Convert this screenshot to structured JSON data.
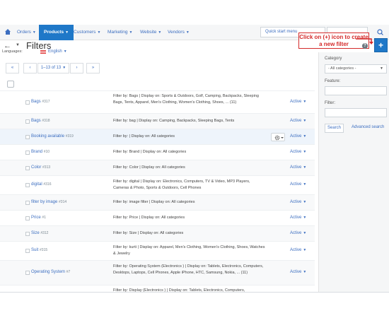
{
  "nav": {
    "items": [
      {
        "label": "Orders",
        "active": false
      },
      {
        "label": "Products",
        "active": true
      },
      {
        "label": "Customers",
        "active": false
      },
      {
        "label": "Marketing",
        "active": false
      },
      {
        "label": "Website",
        "active": false
      },
      {
        "label": "Vendors",
        "active": false
      }
    ],
    "quickstart": "Quick start menu"
  },
  "header": {
    "title": "Filters",
    "callout": "Click on (+) icon to create a new filter",
    "help": "?",
    "add": "+"
  },
  "languages": {
    "label": "Languages:",
    "value": "English"
  },
  "pagination": {
    "first": "«",
    "prev": "‹",
    "range": "1–13 of 13",
    "next": "›",
    "last": "»"
  },
  "rows": [
    {
      "name": "Bags",
      "id": "#317",
      "desc": "Filter by: Bags | Display on: Sports & Outdoors, Golf, Camping, Backpacks, Sleeping Bags, Tents, Apparel, Men's Clothing, Women's Clothing, Shoes, ... (11)",
      "status": "Active"
    },
    {
      "name": "Bags",
      "id": "#318",
      "desc": "Filter by: bag | Display on: Camping, Backpacks, Sleeping Bags, Tents",
      "status": "Active"
    },
    {
      "name": "Booking available",
      "id": "#319",
      "desc": "Filter by: | Display on: All categories",
      "status": "Active"
    },
    {
      "name": "Brand",
      "id": "#10",
      "desc": "Filter by: Brand | Display on: All categories",
      "status": "Active"
    },
    {
      "name": "Color",
      "id": "#313",
      "desc": "Filter by: Color | Display on: All categories",
      "status": "Active"
    },
    {
      "name": "digital",
      "id": "#316",
      "desc": "Filter by: digital | Display on: Electronics, Computers, TV & Video, MP3 Players, Cameras & Photo, Sports & Outdoors, Cell Phones",
      "status": "Active"
    },
    {
      "name": "filter by image",
      "id": "#314",
      "desc": "Filter by: image filter | Display on: All categories",
      "status": "Active"
    },
    {
      "name": "Price",
      "id": "#1",
      "desc": "Filter by: Price | Display on: All categories",
      "status": "Active"
    },
    {
      "name": "Size",
      "id": "#312",
      "desc": "Filter by: Size | Display on: All categories",
      "status": "Active"
    },
    {
      "name": "Suit",
      "id": "#315",
      "desc": "Filter by: kurti | Display on: Apparel, Men's Clothing, Women's Clothing, Shoes, Watches & Jewelry",
      "status": "Active"
    },
    {
      "name": "Operating System",
      "id": "#7",
      "desc": "Filter by: Operating System (Electronics ) | Display on: Tablets, Electronics, Computers, Desktops, Laptops, Cell Phones, Apple iPhone, HTC, Samsung, Nokia, ... (11)",
      "status": "Active"
    },
    {
      "name": "",
      "id": "",
      "desc": "Filter by: Display (Electronics ) | Display on: Tablets, Electronics, Computers,",
      "status": ""
    }
  ],
  "sidebar": {
    "category_label": "Category",
    "category_value": "- All categories -",
    "feature_label": "Feature:",
    "filter_label": "Filter:",
    "search_button": "Search",
    "advanced_link": "Advanced search"
  }
}
